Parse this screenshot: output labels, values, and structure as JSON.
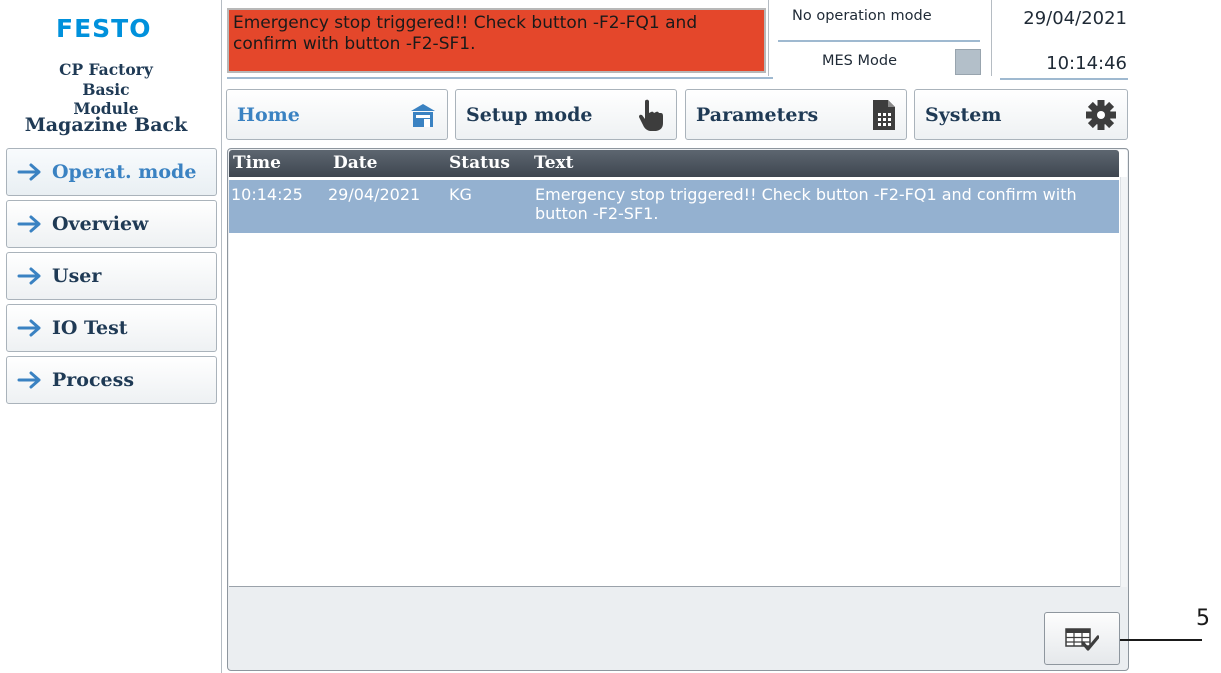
{
  "brand": {
    "logo": "FESTO",
    "line1": "CP Factory",
    "line2": "Basic Module",
    "station": "Magazine Back"
  },
  "nav": {
    "items": [
      {
        "label": "Operat. mode",
        "active": true
      },
      {
        "label": "Overview"
      },
      {
        "label": "User"
      },
      {
        "label": "IO Test"
      },
      {
        "label": "Process"
      }
    ]
  },
  "header": {
    "alarm_text": "Emergency stop triggered!! Check button -F2-FQ1 and confirm with button -F2-SF1.",
    "operation_mode": "No operation mode",
    "mes_label": "MES Mode",
    "date": "29/04/2021",
    "time": "10:14:46"
  },
  "tabs": [
    {
      "label": "Home",
      "icon": "home-icon",
      "active": true
    },
    {
      "label": "Setup mode",
      "icon": "hand-pointer-icon"
    },
    {
      "label": "Parameters",
      "icon": "document-icon"
    },
    {
      "label": "System",
      "icon": "gear-icon"
    }
  ],
  "table": {
    "columns": [
      "Time",
      "Date",
      "Status",
      "Text"
    ],
    "rows": [
      {
        "time": "10:14:25",
        "date": "29/04/2021",
        "status": "KG",
        "text": "Emergency stop triggered!! Check button -F2-FQ1 and confirm with button -F2-SF1."
      }
    ]
  },
  "ack_button": {
    "icon": "acknowledge-list-icon"
  },
  "callout": {
    "number": "5"
  },
  "colors": {
    "alarm": "#e4472b",
    "selected_row": "#94b1d0",
    "accent": "#3a82c2",
    "brand": "#0091dc"
  }
}
